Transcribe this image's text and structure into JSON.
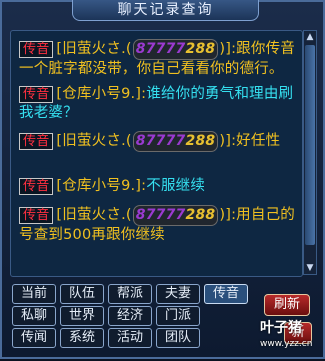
{
  "window": {
    "title": "聊天记录查询"
  },
  "messages": [
    {
      "channel": "传音",
      "sender": "[旧萤火さ.",
      "id_colored": [
        "8",
        "7",
        "7",
        "7",
        "7",
        "2",
        "8",
        "8"
      ],
      "sender_close": ")]:",
      "text": "跟你传音一个脏字都没带，你自己看看你的德行。",
      "text_color": "#f0c020"
    },
    {
      "channel": "传音",
      "sender": "[仓库小号9.]:",
      "text": "谁给你的勇气和理由刷我老婆？",
      "text_color": "#35e0f0"
    },
    {
      "channel": "传音",
      "sender": "[旧萤火さ.",
      "id_colored": [
        "8",
        "7",
        "7",
        "7",
        "7",
        "2",
        "8",
        "8"
      ],
      "sender_close": ")]:",
      "text": "好任性",
      "text_color": "#f0c020"
    },
    {
      "channel": "传音",
      "sender": "[仓库小号9.]:",
      "text": "不服继续",
      "text_color": "#35e0f0"
    },
    {
      "channel": "传音",
      "sender": "[旧萤火さ.",
      "id_colored": [
        "8",
        "7",
        "7",
        "7",
        "7",
        "2",
        "8",
        "8"
      ],
      "sender_close": ")]:",
      "text": "用自己的号查到500再跟你继续",
      "text_color": "#f0c020"
    }
  ],
  "tabs": {
    "row1": [
      "当前",
      "队伍",
      "帮派",
      "夫妻",
      "传音"
    ],
    "row2": [
      "私聊",
      "世界",
      "经济",
      "门派"
    ],
    "row3": [
      "传闻",
      "系统",
      "活动",
      "团队"
    ],
    "active": "传音"
  },
  "buttons": {
    "refresh": "刷新",
    "second": "新"
  },
  "watermark": {
    "logo": "叶子猪",
    "url": "www.yzz.cn"
  },
  "colors": {
    "channel_border": "#c8c8c8",
    "channel_text": "#ff3040",
    "name": "#f0c020",
    "reply": "#35e0f0"
  }
}
